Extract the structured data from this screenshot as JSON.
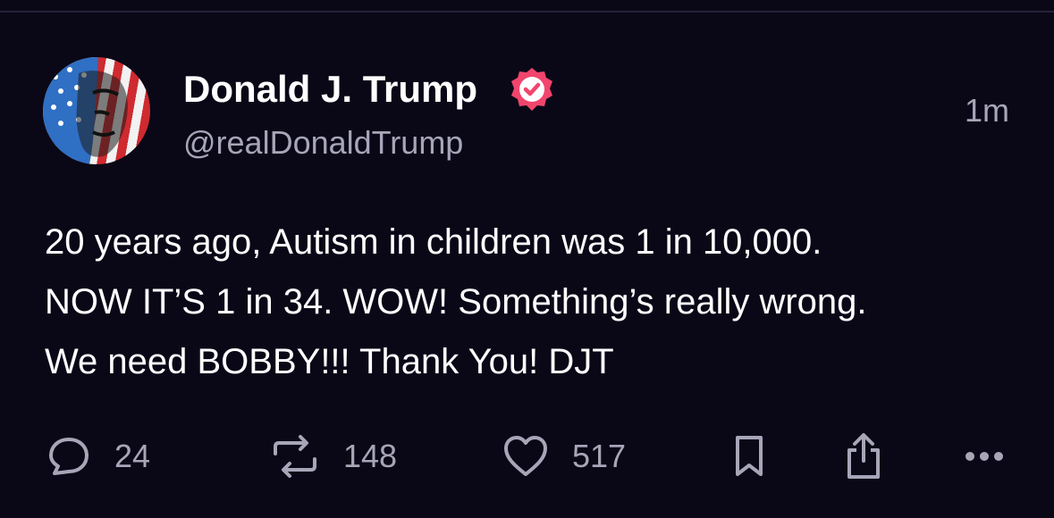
{
  "post": {
    "author": {
      "display_name": "Donald J. Trump",
      "handle": "@realDonaldTrump",
      "verified": true,
      "avatar_icon": "avatar-flag-portrait-icon"
    },
    "timestamp": "1m",
    "text_lines": [
      "20 years ago, Autism in children was 1 in 10,000.",
      "NOW IT’S 1 in 34. WOW! Something’s really wrong.",
      "We need BOBBY!!! Thank You! DJT"
    ],
    "actions": {
      "replies": "24",
      "reposts": "148",
      "likes": "517"
    },
    "action_icons": [
      "reply-icon",
      "repost-icon",
      "heart-icon",
      "bookmark-icon",
      "share-icon",
      "more-icon"
    ]
  },
  "colors": {
    "background": "#0a0817",
    "text_primary": "#ffffff",
    "text_secondary": "#a7a6b8",
    "verified_badge": "#f1456d",
    "divider": "#24233a"
  }
}
